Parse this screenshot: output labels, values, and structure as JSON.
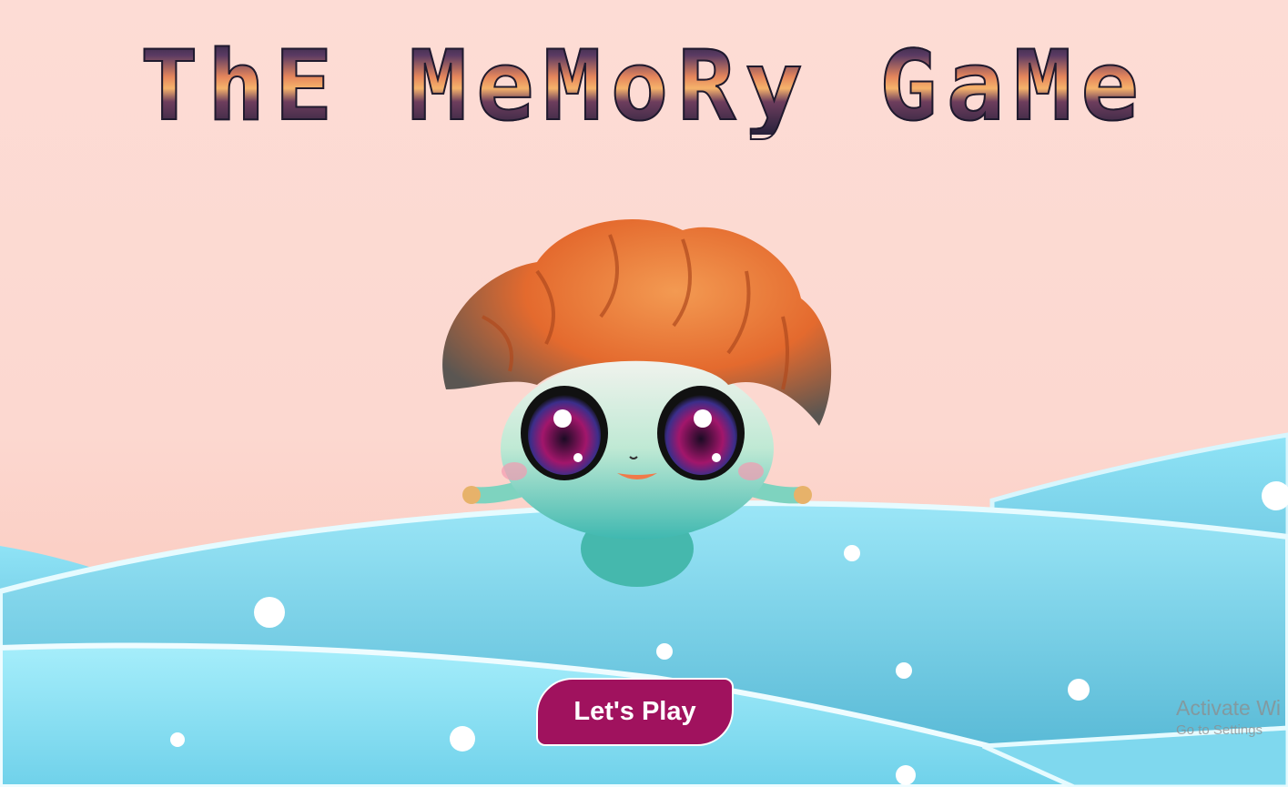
{
  "game": {
    "title": "ThE MeMoRy GaMe",
    "play_button_label": "Let's Play",
    "mascot_icon": "brain-mascot-icon",
    "colors": {
      "play_button": "#a0125e",
      "sky": "#fddcd5",
      "snow_hills": "#8ee3f5"
    }
  },
  "os_watermark": {
    "line1": "Activate Wi",
    "line2": "Go to Settings"
  }
}
